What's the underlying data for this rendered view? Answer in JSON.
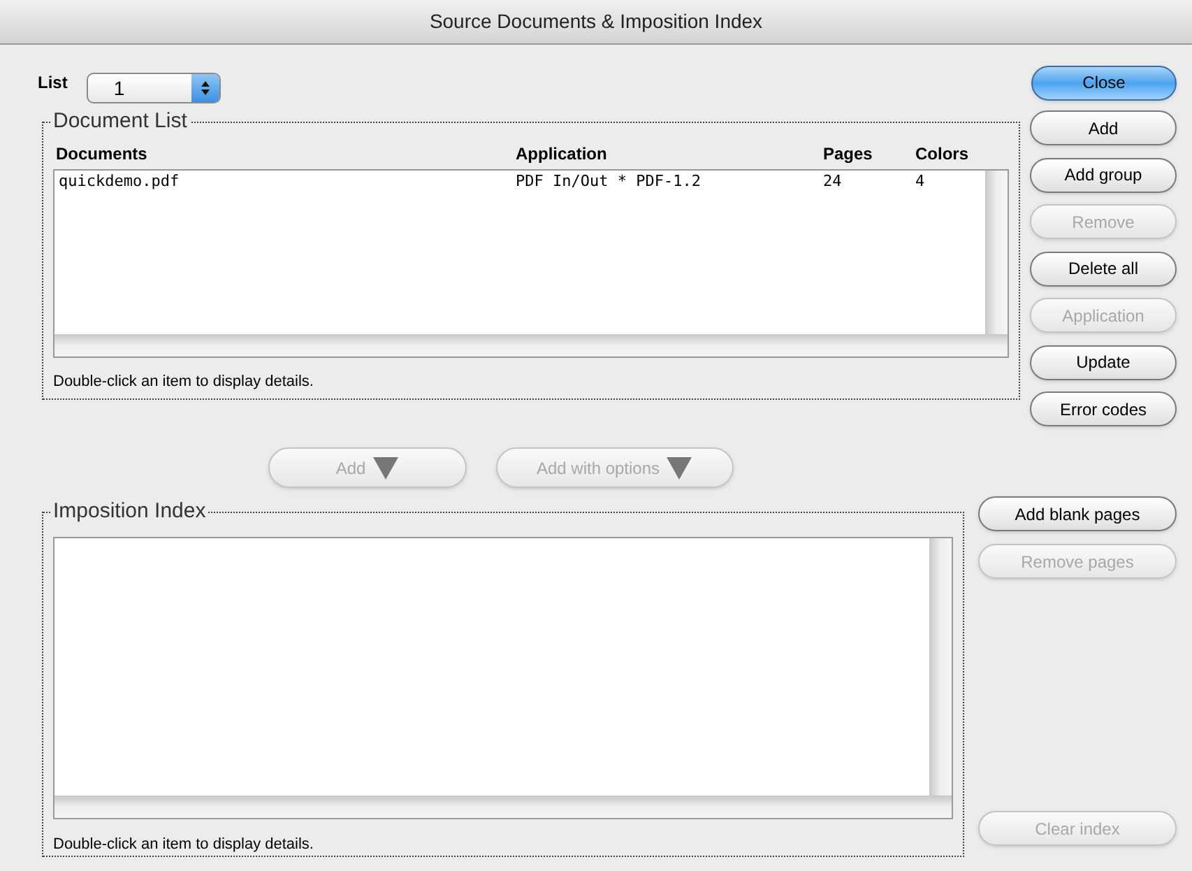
{
  "window": {
    "title": "Source Documents & Imposition Index"
  },
  "list_selector": {
    "label": "List",
    "value": "1"
  },
  "close_button": {
    "label": "Close",
    "default": true
  },
  "document_list": {
    "title": "Document List",
    "columns": [
      "Documents",
      "Application",
      "Pages",
      "Colors"
    ],
    "rows": [
      [
        "quickdemo.pdf",
        "PDF In/Out * PDF-1.2",
        "24",
        "4"
      ]
    ],
    "hint": "Double-click an item to display details."
  },
  "document_buttons": [
    {
      "label": "Add",
      "disabled": false
    },
    {
      "label": "Add group",
      "disabled": false
    },
    {
      "label": "Remove",
      "disabled": true
    },
    {
      "label": "Delete all",
      "disabled": false
    },
    {
      "label": "Application",
      "disabled": true
    },
    {
      "label": "Update",
      "disabled": false
    },
    {
      "label": "Error codes",
      "disabled": false
    }
  ],
  "transfer_buttons": [
    {
      "label": "Add",
      "disabled": true
    },
    {
      "label": "Add with options",
      "disabled": true
    }
  ],
  "imposition_index": {
    "title": "Imposition Index",
    "hint": "Double-click an item to display details."
  },
  "index_buttons": [
    {
      "label": "Add blank pages",
      "disabled": false
    },
    {
      "label": "Remove pages",
      "disabled": true
    }
  ],
  "clear_button": {
    "label": "Clear index",
    "disabled": true
  }
}
